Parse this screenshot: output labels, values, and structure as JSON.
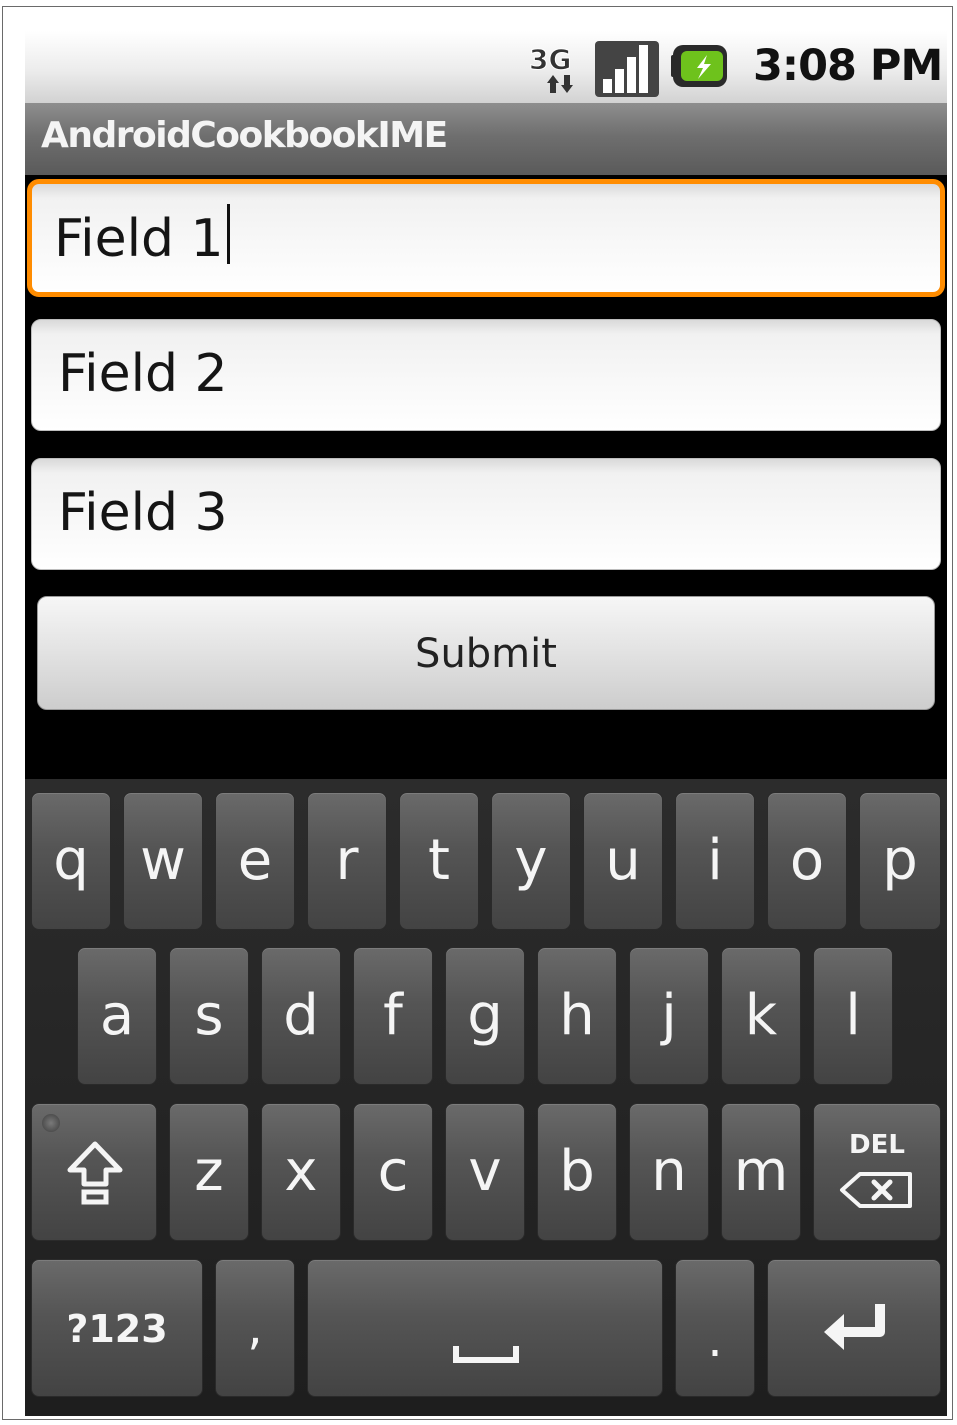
{
  "status_bar": {
    "network_icon": "3g-data-icon",
    "signal_icon": "signal-strength-icon",
    "battery_icon": "battery-charging-icon",
    "time": "3:08 PM"
  },
  "app": {
    "title": "AndroidCookbookIME"
  },
  "form": {
    "fields": [
      {
        "value": "Field 1",
        "focused": true
      },
      {
        "value": "Field 2",
        "focused": false
      },
      {
        "value": "Field 3",
        "focused": false
      }
    ],
    "submit_label": "Submit"
  },
  "keyboard": {
    "row1": [
      "q",
      "w",
      "e",
      "r",
      "t",
      "y",
      "u",
      "i",
      "o",
      "p"
    ],
    "row2": [
      "a",
      "s",
      "d",
      "f",
      "g",
      "h",
      "j",
      "k",
      "l"
    ],
    "row3": [
      "z",
      "x",
      "c",
      "v",
      "b",
      "n",
      "m"
    ],
    "shift_icon": "shift-arrow-icon",
    "delete_label": "DEL",
    "symbols_label": "?123",
    "comma_label": ",",
    "period_label": ".",
    "space_icon": "space-bar-icon",
    "enter_icon": "enter-return-icon",
    "accent_color": "#ff8c00"
  }
}
